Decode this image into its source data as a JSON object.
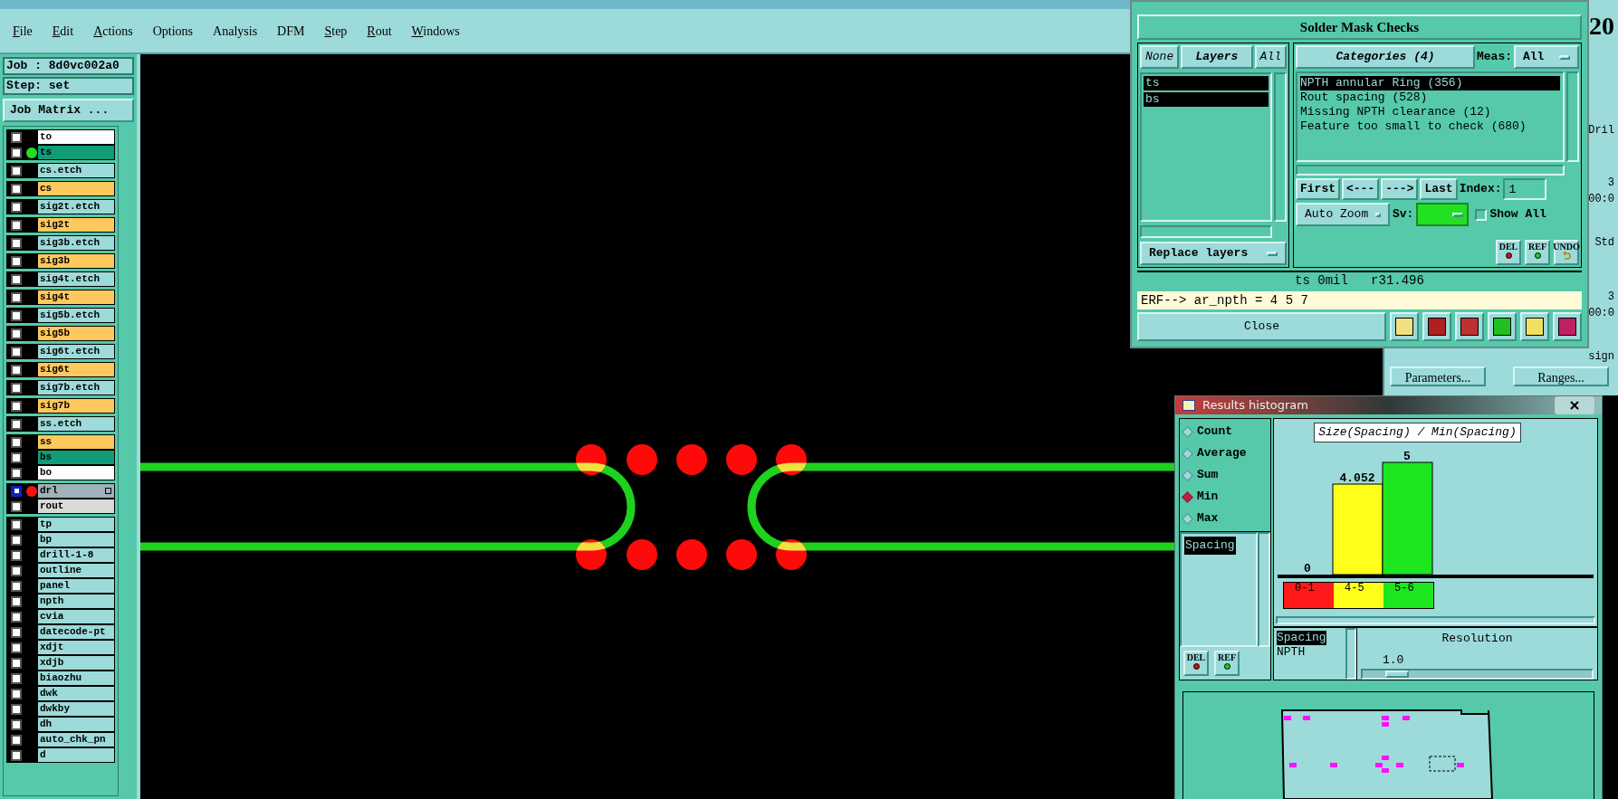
{
  "menu": [
    {
      "label": "File",
      "underlined_initial": true
    },
    {
      "label": "Edit",
      "underlined_initial": true
    },
    {
      "label": "Actions",
      "underlined_initial": true
    },
    {
      "label": "Options",
      "underlined_initial": false
    },
    {
      "label": "Analysis",
      "underlined_initial": false
    },
    {
      "label": "DFM",
      "underlined_initial": false
    },
    {
      "label": "Step",
      "underlined_initial": true
    },
    {
      "label": "Rout",
      "underlined_initial": true
    },
    {
      "label": "Windows",
      "underlined_initial": true
    }
  ],
  "job": {
    "job_label": "Job : 8d0vc002a0",
    "step_label": "Step: set",
    "matrix_button": "Job Matrix ..."
  },
  "layer_groups": [
    {
      "layers": [
        {
          "name": "to",
          "color": "#ffffff",
          "selected": false
        },
        {
          "name": "ts",
          "color": "#109c78",
          "selected": false,
          "dot": {
            "color": "#22dd22"
          }
        }
      ]
    },
    {
      "layers": [
        {
          "name": "cs.etch",
          "color": "#9ddada",
          "selected": false
        }
      ]
    },
    {
      "layers": [
        {
          "name": "cs",
          "color": "#ffc85c",
          "selected": false
        }
      ]
    },
    {
      "layers": [
        {
          "name": "sig2t.etch",
          "color": "#9ddada",
          "selected": false
        }
      ]
    },
    {
      "layers": [
        {
          "name": "sig2t",
          "color": "#ffc85c",
          "selected": false
        }
      ]
    },
    {
      "layers": [
        {
          "name": "sig3b.etch",
          "color": "#9ddada",
          "selected": false
        }
      ]
    },
    {
      "layers": [
        {
          "name": "sig3b",
          "color": "#ffc85c",
          "selected": false
        }
      ]
    },
    {
      "layers": [
        {
          "name": "sig4t.etch",
          "color": "#9ddada",
          "selected": false
        }
      ]
    },
    {
      "layers": [
        {
          "name": "sig4t",
          "color": "#ffc85c",
          "selected": false
        }
      ]
    },
    {
      "layers": [
        {
          "name": "sig5b.etch",
          "color": "#9ddada",
          "selected": false
        }
      ]
    },
    {
      "layers": [
        {
          "name": "sig5b",
          "color": "#ffc85c",
          "selected": false
        }
      ]
    },
    {
      "layers": [
        {
          "name": "sig6t.etch",
          "color": "#9ddada",
          "selected": false
        }
      ]
    },
    {
      "layers": [
        {
          "name": "sig6t",
          "color": "#ffc85c",
          "selected": false
        }
      ]
    },
    {
      "layers": [
        {
          "name": "sig7b.etch",
          "color": "#9ddada",
          "selected": false
        }
      ]
    },
    {
      "layers": [
        {
          "name": "sig7b",
          "color": "#ffc85c",
          "selected": false
        }
      ]
    },
    {
      "layers": [
        {
          "name": "ss.etch",
          "color": "#9ddada",
          "selected": false
        }
      ]
    },
    {
      "layers": [
        {
          "name": "ss",
          "color": "#ffc85c",
          "selected": false
        },
        {
          "name": "bs",
          "color": "#109c78",
          "selected": false
        },
        {
          "name": "bo",
          "color": "#ffffff",
          "selected": false
        }
      ]
    },
    {
      "layers": [
        {
          "name": "drl",
          "color": "#9fb1b9",
          "selected": true,
          "dot": {
            "color": "#ff1010"
          }
        },
        {
          "name": "rout",
          "color": "#d9d9d9",
          "selected": false
        }
      ]
    },
    {
      "layers": [
        {
          "name": "tp",
          "color": "#9ddada",
          "selected": false
        },
        {
          "name": "bp",
          "color": "#9ddada",
          "selected": false
        },
        {
          "name": "drill-1-8",
          "color": "#9ddada",
          "selected": false
        },
        {
          "name": "outline",
          "color": "#9ddada",
          "selected": false
        },
        {
          "name": "panel",
          "color": "#9ddada",
          "selected": false
        },
        {
          "name": "npth",
          "color": "#9ddada",
          "selected": false
        },
        {
          "name": "cvia",
          "color": "#9ddada",
          "selected": false
        },
        {
          "name": "datecode-pt",
          "color": "#9ddada",
          "selected": false
        },
        {
          "name": "xdjt",
          "color": "#9ddada",
          "selected": false
        },
        {
          "name": "xdjb",
          "color": "#9ddada",
          "selected": false
        },
        {
          "name": "biaozhu",
          "color": "#9ddada",
          "selected": false
        },
        {
          "name": "dwk",
          "color": "#9ddada",
          "selected": false
        },
        {
          "name": "dwkby",
          "color": "#9ddada",
          "selected": false
        },
        {
          "name": "dh",
          "color": "#9ddada",
          "selected": false
        },
        {
          "name": "auto_chk_pn",
          "color": "#9ddada",
          "selected": false
        },
        {
          "name": "d",
          "color": "#9ddada",
          "selected": false
        }
      ]
    }
  ],
  "background_window": {
    "fragments": [
      "20",
      "Dril",
      "3",
      "00:0",
      "Std",
      "3",
      "00:0",
      "sign"
    ],
    "buttons": [
      "Parameters...",
      "Ranges..."
    ]
  },
  "results_viewer": {
    "heading": "Solder Mask Checks",
    "layer_buttons": [
      {
        "label": "None",
        "bold": false
      },
      {
        "label": "Layers",
        "bold": true
      },
      {
        "label": "All",
        "bold": false
      }
    ],
    "layers": [
      {
        "label": "ts",
        "selected": true
      },
      {
        "label": "bs",
        "selected": true
      }
    ],
    "replace_dropdown": "Replace layers",
    "categories_button": "Categories (4)",
    "meas_label": "Meas:",
    "meas_value": "All",
    "categories": [
      {
        "label": "NPTH annular Ring (356)",
        "selected": true
      },
      {
        "label": "Rout spacing (528)",
        "selected": false
      },
      {
        "label": "Missing NPTH clearance (12)",
        "selected": false
      },
      {
        "label": "Feature too small to check (680)",
        "selected": false
      }
    ],
    "nav_buttons": [
      "First",
      "<---",
      "--->",
      "Last"
    ],
    "index_label": "Index:",
    "index_value": "1",
    "zoom_dropdown": "Auto Zoom",
    "sv_label": "Sv:",
    "sv_swatch": {
      "color": "#22e022"
    },
    "show_all": {
      "label": "Show All",
      "checked": false
    },
    "action_buttons": [
      {
        "label": "DEL",
        "kind": "del"
      },
      {
        "label": "REF",
        "kind": "ref"
      },
      {
        "label": "UNDO",
        "kind": "undo"
      }
    ],
    "status": "ts 0mil   r31.496",
    "erf_line": "ERF--> ar_npth = 4 5 7",
    "close_button": "Close"
  },
  "histogram": {
    "title": "Results histogram",
    "modes": [
      {
        "label": "Count",
        "selected": false
      },
      {
        "label": "Average",
        "selected": false
      },
      {
        "label": "Sum",
        "selected": false
      },
      {
        "label": "Min",
        "selected": true
      },
      {
        "label": "Max",
        "selected": false
      }
    ],
    "measures": [
      {
        "label": "Spacing",
        "selected": true
      }
    ],
    "buttons": [
      {
        "label": "DEL",
        "kind": "del"
      },
      {
        "label": "REF",
        "kind": "ref"
      }
    ],
    "chart_title": "Size(Spacing) / Min(Spacing)",
    "bars": [
      {
        "value_label": "0"
      },
      {
        "value_label": "4.052"
      },
      {
        "value_label": "5"
      }
    ],
    "bins": [
      {
        "label": "0-1",
        "color": "#ff1a1a"
      },
      {
        "label": "4-5",
        "color": "#ffff1a"
      },
      {
        "label": "5-6",
        "color": "#1ee61e"
      }
    ],
    "types": [
      {
        "label": "Spacing",
        "selected": true
      },
      {
        "label": "NPTH",
        "selected": false
      }
    ],
    "resolution_label": "Resolution",
    "resolution_value": "1.0",
    "resolution_slider": {
      "level": 0.1
    }
  }
}
